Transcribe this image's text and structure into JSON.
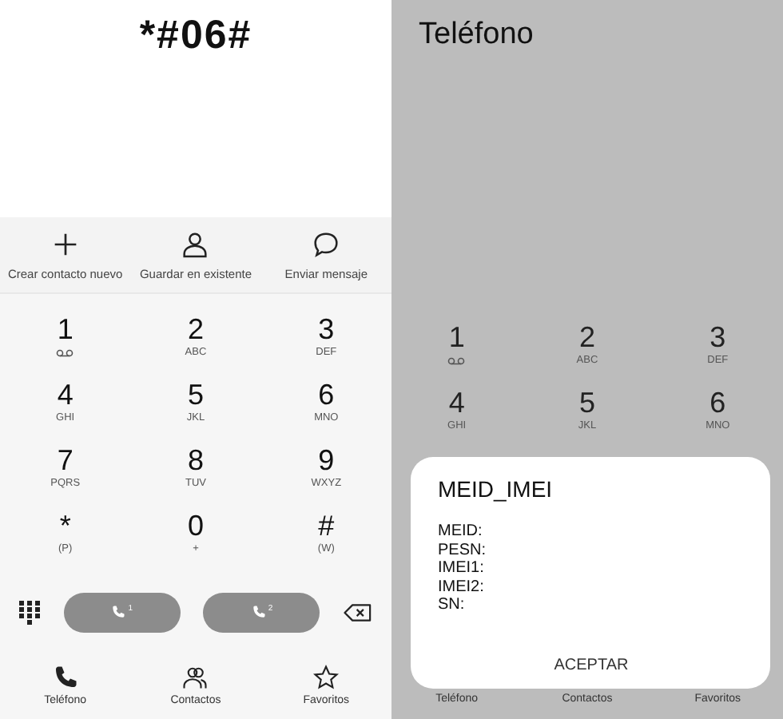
{
  "dialer": {
    "entered_number": "*#06#",
    "actions": [
      {
        "label": "Crear contacto nuevo"
      },
      {
        "label": "Guardar en existente"
      },
      {
        "label": "Enviar mensaje"
      }
    ],
    "keys": [
      {
        "digit": "1",
        "kind": "voicemail"
      },
      {
        "digit": "2",
        "kind": "letters",
        "sub": "ABC"
      },
      {
        "digit": "3",
        "kind": "letters",
        "sub": "DEF"
      },
      {
        "digit": "4",
        "kind": "letters",
        "sub": "GHI"
      },
      {
        "digit": "5",
        "kind": "letters",
        "sub": "JKL"
      },
      {
        "digit": "6",
        "kind": "letters",
        "sub": "MNO"
      },
      {
        "digit": "7",
        "kind": "letters",
        "sub": "PQRS"
      },
      {
        "digit": "8",
        "kind": "letters",
        "sub": "TUV"
      },
      {
        "digit": "9",
        "kind": "letters",
        "sub": "WXYZ"
      },
      {
        "digit": "*",
        "kind": "letters",
        "sub": "(P)"
      },
      {
        "digit": "0",
        "kind": "letters",
        "sub": "+"
      },
      {
        "digit": "#",
        "kind": "letters",
        "sub": "(W)"
      }
    ],
    "call_buttons": [
      {
        "sim": "1"
      },
      {
        "sim": "2"
      }
    ],
    "nav": [
      {
        "label": "Teléfono"
      },
      {
        "label": "Contactos"
      },
      {
        "label": "Favoritos"
      }
    ]
  },
  "dimmed_dialer": {
    "title": "Teléfono",
    "keys": [
      {
        "digit": "1",
        "kind": "voicemail"
      },
      {
        "digit": "2",
        "kind": "letters",
        "sub": "ABC"
      },
      {
        "digit": "3",
        "kind": "letters",
        "sub": "DEF"
      },
      {
        "digit": "4",
        "kind": "letters",
        "sub": "GHI"
      },
      {
        "digit": "5",
        "kind": "letters",
        "sub": "JKL"
      },
      {
        "digit": "6",
        "kind": "letters",
        "sub": "MNO"
      }
    ],
    "nav": [
      {
        "label": "Teléfono"
      },
      {
        "label": "Contactos"
      },
      {
        "label": "Favoritos"
      }
    ]
  },
  "dialog": {
    "title": "MEID_IMEI",
    "lines": [
      "MEID:",
      "PESN:",
      "IMEI1:",
      "IMEI2:",
      "SN:"
    ],
    "button": "ACEPTAR"
  }
}
